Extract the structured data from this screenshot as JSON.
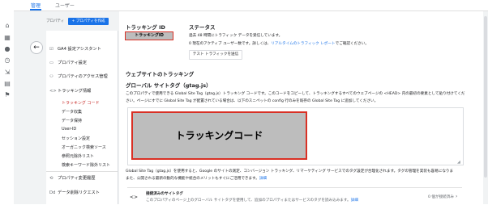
{
  "tabs": {
    "admin": "管理",
    "user": "ユーザー"
  },
  "property": {
    "label": "プロパティ",
    "create_button": "+ プロパティを作成"
  },
  "nav": {
    "items": [
      {
        "icon": "check-square-icon",
        "glyph": "☑",
        "label": "GA4 設定アシスタント"
      },
      {
        "icon": "settings-box-icon",
        "glyph": "▭",
        "label": "プロパティ設定"
      },
      {
        "icon": "people-icon",
        "glyph": "⚇",
        "label": "プロパティのアクセス管理"
      },
      {
        "icon": "code-icon",
        "glyph": "<>",
        "label": "トラッキング情報"
      }
    ],
    "sub": [
      "トラッキング コード",
      "データ収集",
      "データ保持",
      "User-ID",
      "セッション設定",
      "オーガニック検索ソース",
      "参照元除外リスト",
      "検索キーワード除外リスト"
    ],
    "bottom": [
      {
        "icon": "history-icon",
        "glyph": "⟲",
        "label": "プロパティ変更履歴"
      },
      {
        "icon": "dd-icon",
        "glyph": "Dd",
        "label": "データ削除リクエスト"
      }
    ]
  },
  "tracking": {
    "id_label": "トラッキング ID",
    "id_value": "トラッキングID",
    "status_label": "ステータス",
    "status_line1": "過去 48 時間にトラフィック データを受信しています。",
    "status_line2": "0 現在のアクティブ ユーザー数です。詳しくは、",
    "status_link": "リアルタイムのトラフィック レポート",
    "status_line2_end": "でご確認ください。",
    "test_button": "テスト トラフィックを送信"
  },
  "website": {
    "heading": "ウェブサイトのトラッキング",
    "gtag_heading": "グローバル サイトタグ（gtag.js）",
    "desc1": "このプロパティで使用できる Global Site Tag（gtag.js）トラッキング コードです。このコードをコピーして、トラッキングするすべてのウェブページの <HEAD> 内の最初の要素として貼り付けてくだ",
    "desc2": "さい。ページにすでに Global Site Tag が配置されている場合は、以下のスニペットの config 行のみを既存の Global Site Tag に追加してください。",
    "code_value": "トラッキングコード",
    "footer1": "Global Site Tag（gtag.js）を使用すると、Google のサイトの測定、コンバージョン トラッキング、リマーケティング サービスでのタグ設定が合理化されます。タグの管理を実装も容易になりま",
    "footer2": "また、公開される最新の動的な機能や統合のメリットもすぐにご活用できます。",
    "footer_link": "詳細"
  },
  "connected": {
    "title": "接続済みのサイトタグ",
    "desc": "このプロパティのページ上のグローバル サイトタグを使用して、追加のプロパティまたはサービスのタグを読み込みます。",
    "link": "詳細",
    "count": "0 個が接続済み"
  },
  "colors": {
    "accent": "#1a73e8",
    "highlight": "#d93025"
  }
}
